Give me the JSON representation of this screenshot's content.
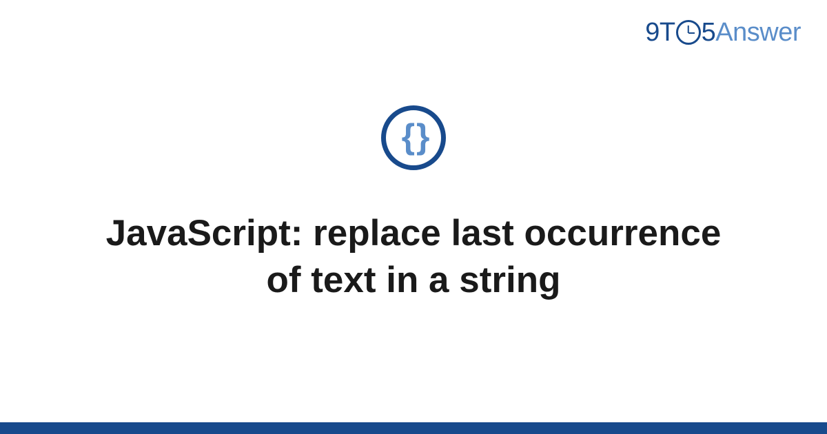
{
  "logo": {
    "part1": "9T",
    "part2": "5",
    "part3": "Answer"
  },
  "badge": {
    "icon_name": "braces-icon",
    "glyph": "{ }"
  },
  "title": "JavaScript: replace last occurrence of text in a string",
  "colors": {
    "primary": "#184a8c",
    "secondary": "#5a8dc9"
  }
}
